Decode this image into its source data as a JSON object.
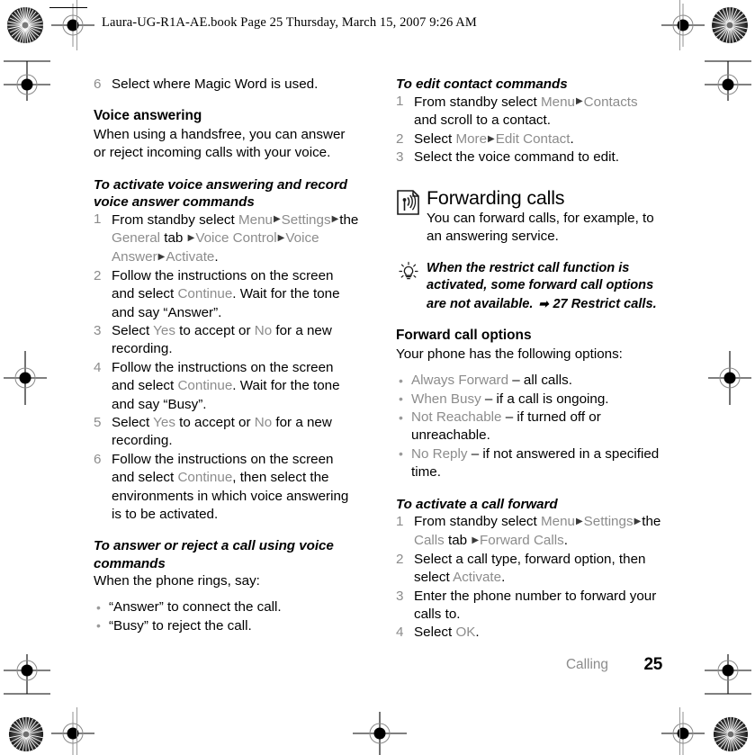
{
  "page": {
    "header_line": "Laura-UG-R1A-AE.book  Page 25  Thursday, March 15, 2007  9:26 AM",
    "footer_chapter": "Calling",
    "footer_page_number": "25",
    "ui_term_color": "#8c8c8c",
    "text_color": "#000000",
    "background": "#ffffff"
  },
  "left_column": {
    "step6_continued": {
      "number": "6",
      "text": "Select where Magic Word is used."
    },
    "voice_answering": {
      "heading": "Voice answering",
      "body": "When using a handsfree, you can answer or reject incoming calls with your voice."
    },
    "task_activate": {
      "heading": "To activate voice answering and record voice answer commands",
      "steps": [
        {
          "number": "1",
          "parts": [
            {
              "t": "From standby select ",
              "s": "plain"
            },
            {
              "t": "Menu",
              "s": "ui"
            },
            {
              "t": "▶",
              "s": "sep"
            },
            {
              "t": "Settings",
              "s": "ui"
            },
            {
              "t": "▶",
              "s": "sep"
            },
            {
              "t": "the ",
              "s": "plain"
            },
            {
              "t": "General",
              "s": "ui"
            },
            {
              "t": " tab ",
              "s": "plain"
            },
            {
              "t": "▶",
              "s": "sep"
            },
            {
              "t": "Voice Control",
              "s": "ui"
            },
            {
              "t": "▶",
              "s": "sep"
            },
            {
              "t": "Voice Answer",
              "s": "ui"
            },
            {
              "t": "▶",
              "s": "sep"
            },
            {
              "t": "Activate",
              "s": "ui"
            },
            {
              "t": ".",
              "s": "plain"
            }
          ]
        },
        {
          "number": "2",
          "parts": [
            {
              "t": "Follow the instructions on the screen and select ",
              "s": "plain"
            },
            {
              "t": "Continue",
              "s": "ui"
            },
            {
              "t": ". Wait for the tone and say “Answer”.",
              "s": "plain"
            }
          ]
        },
        {
          "number": "3",
          "parts": [
            {
              "t": "Select ",
              "s": "plain"
            },
            {
              "t": "Yes",
              "s": "ui"
            },
            {
              "t": " to accept or ",
              "s": "plain"
            },
            {
              "t": "No",
              "s": "ui"
            },
            {
              "t": " for a new recording.",
              "s": "plain"
            }
          ]
        },
        {
          "number": "4",
          "parts": [
            {
              "t": "Follow the instructions on the screen and select ",
              "s": "plain"
            },
            {
              "t": "Continue",
              "s": "ui"
            },
            {
              "t": ". Wait for the tone and say “Busy”.",
              "s": "plain"
            }
          ]
        },
        {
          "number": "5",
          "parts": [
            {
              "t": "Select ",
              "s": "plain"
            },
            {
              "t": "Yes",
              "s": "ui"
            },
            {
              "t": " to accept or ",
              "s": "plain"
            },
            {
              "t": "No",
              "s": "ui"
            },
            {
              "t": " for a new recording.",
              "s": "plain"
            }
          ]
        },
        {
          "number": "6",
          "parts": [
            {
              "t": "Follow the instructions on the screen and select ",
              "s": "plain"
            },
            {
              "t": "Continue",
              "s": "ui"
            },
            {
              "t": ", then select the environments in which voice answering is to be activated.",
              "s": "plain"
            }
          ]
        }
      ]
    },
    "task_answer_reject": {
      "heading": "To answer or reject a call using voice commands",
      "intro": "When the phone rings, say:",
      "bullets": [
        "“Answer” to connect the call.",
        "“Busy” to reject the call."
      ]
    }
  },
  "right_column": {
    "task_edit_contact": {
      "heading": "To edit contact commands",
      "steps": [
        {
          "number": "1",
          "parts": [
            {
              "t": "From standby select ",
              "s": "plain"
            },
            {
              "t": "Menu",
              "s": "ui"
            },
            {
              "t": "▶",
              "s": "sep"
            },
            {
              "t": "Contacts",
              "s": "ui"
            },
            {
              "t": " and scroll to a contact.",
              "s": "plain"
            }
          ]
        },
        {
          "number": "2",
          "parts": [
            {
              "t": "Select ",
              "s": "plain"
            },
            {
              "t": "More",
              "s": "ui"
            },
            {
              "t": "▶",
              "s": "sep"
            },
            {
              "t": "Edit Contact",
              "s": "ui"
            },
            {
              "t": ".",
              "s": "plain"
            }
          ]
        },
        {
          "number": "3",
          "parts": [
            {
              "t": "Select the voice command to edit.",
              "s": "plain"
            }
          ]
        }
      ]
    },
    "forwarding_calls": {
      "icon": "document-broadcast-icon",
      "heading": "Forwarding calls",
      "body": "You can forward calls, for example, to an answering service."
    },
    "tip_note": {
      "icon": "lightbulb-tip-icon",
      "parts": [
        {
          "t": "When the restrict call function is activated, some forward call options are not available. ",
          "s": "plain"
        },
        {
          "t": "➡",
          "s": "arrow"
        },
        {
          "t": " 27 Restrict calls.",
          "s": "plain"
        }
      ]
    },
    "forward_call_options": {
      "heading": "Forward call options",
      "body": "Your phone has the following options:",
      "bullets": [
        {
          "parts": [
            {
              "t": "Always Forward",
              "s": "ui"
            },
            {
              "t": " – all calls.",
              "s": "plain"
            }
          ]
        },
        {
          "parts": [
            {
              "t": "When Busy",
              "s": "ui"
            },
            {
              "t": " – if a call is ongoing.",
              "s": "plain"
            }
          ]
        },
        {
          "parts": [
            {
              "t": "Not Reachable",
              "s": "ui"
            },
            {
              "t": " – if turned off or unreachable.",
              "s": "plain"
            }
          ]
        },
        {
          "parts": [
            {
              "t": "No Reply",
              "s": "ui"
            },
            {
              "t": " – if not answered in a specified time.",
              "s": "plain"
            }
          ]
        }
      ]
    },
    "task_activate_forward": {
      "heading": "To activate a call forward",
      "steps": [
        {
          "number": "1",
          "parts": [
            {
              "t": "From standby select ",
              "s": "plain"
            },
            {
              "t": "Menu",
              "s": "ui"
            },
            {
              "t": "▶",
              "s": "sep"
            },
            {
              "t": "Settings",
              "s": "ui"
            },
            {
              "t": "▶",
              "s": "sep"
            },
            {
              "t": "the ",
              "s": "plain"
            },
            {
              "t": "Calls",
              "s": "ui"
            },
            {
              "t": " tab ",
              "s": "plain"
            },
            {
              "t": "▶",
              "s": "sep"
            },
            {
              "t": "Forward Calls",
              "s": "ui"
            },
            {
              "t": ".",
              "s": "plain"
            }
          ]
        },
        {
          "number": "2",
          "parts": [
            {
              "t": "Select a call type, forward option, then select ",
              "s": "plain"
            },
            {
              "t": "Activate",
              "s": "ui"
            },
            {
              "t": ".",
              "s": "plain"
            }
          ]
        },
        {
          "number": "3",
          "parts": [
            {
              "t": "Enter the phone number to forward your calls to.",
              "s": "plain"
            }
          ]
        },
        {
          "number": "4",
          "parts": [
            {
              "t": "Select ",
              "s": "plain"
            },
            {
              "t": "OK",
              "s": "ui"
            },
            {
              "t": ".",
              "s": "plain"
            }
          ]
        }
      ]
    }
  }
}
